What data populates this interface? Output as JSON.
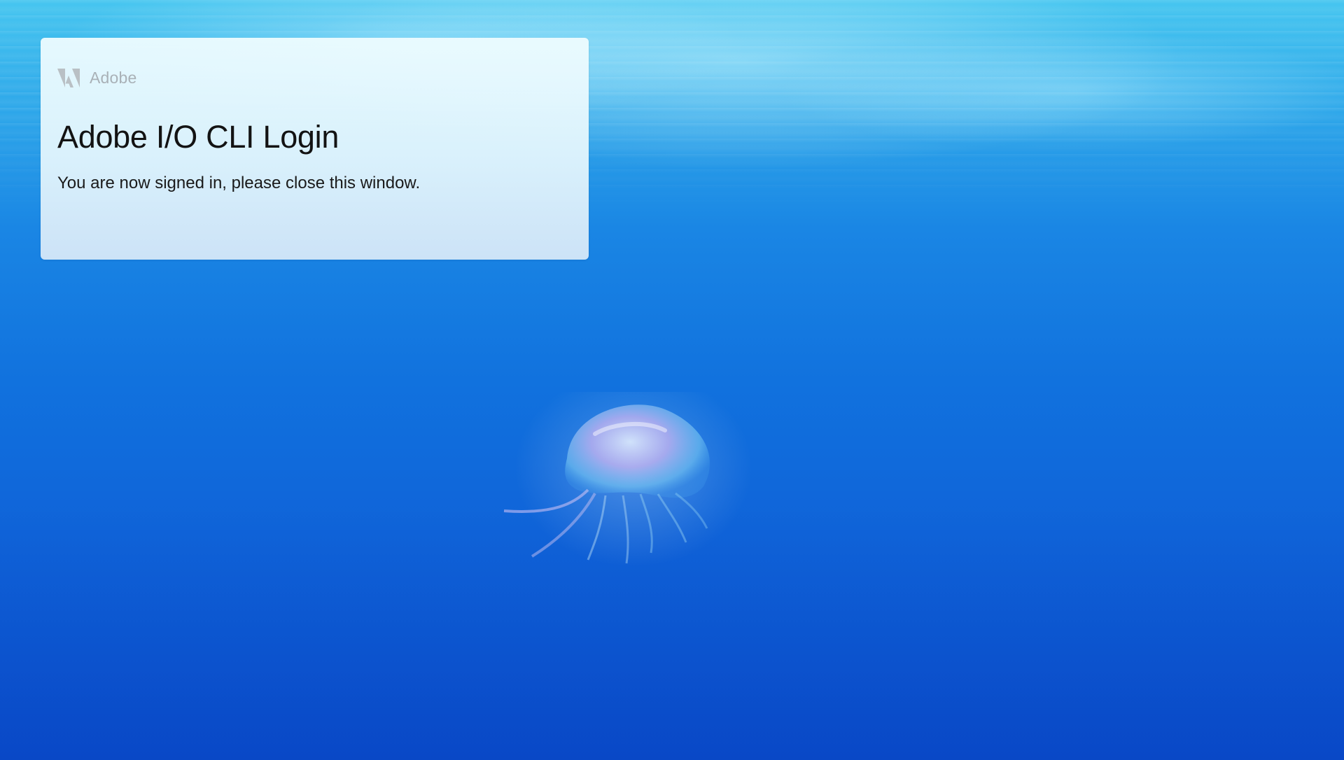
{
  "brand": {
    "name": "Adobe",
    "logo_icon": "adobe-logo-icon",
    "color": "#a9b1b7"
  },
  "card": {
    "title": "Adobe I/O CLI Login",
    "message": "You are now signed in, please close this window."
  },
  "background": {
    "subject": "jellyfish-underwater-wallpaper",
    "colors": [
      "#46c6f0",
      "#1a86e4",
      "#0b4fcf"
    ]
  }
}
